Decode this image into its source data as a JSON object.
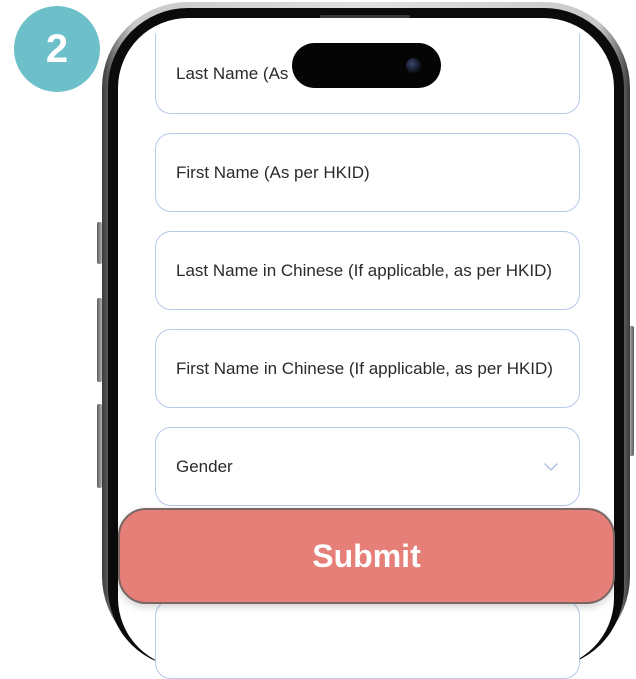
{
  "step_number": "2",
  "form": {
    "last_name_label": "Last Name (As",
    "first_name_label": "First Name (As per HKID)",
    "last_name_chinese_label": "Last Name in Chinese (If applicable, as per HKID)",
    "first_name_chinese_label": "First Name in Chinese (If applicable, as per HKID)",
    "gender_label": "Gender",
    "gender_icon": "chevron-down-icon"
  },
  "submit_label": "Submit",
  "colors": {
    "badge": "#6dbfc9",
    "field_border": "#b8c9ea",
    "submit": "#e57f78"
  }
}
